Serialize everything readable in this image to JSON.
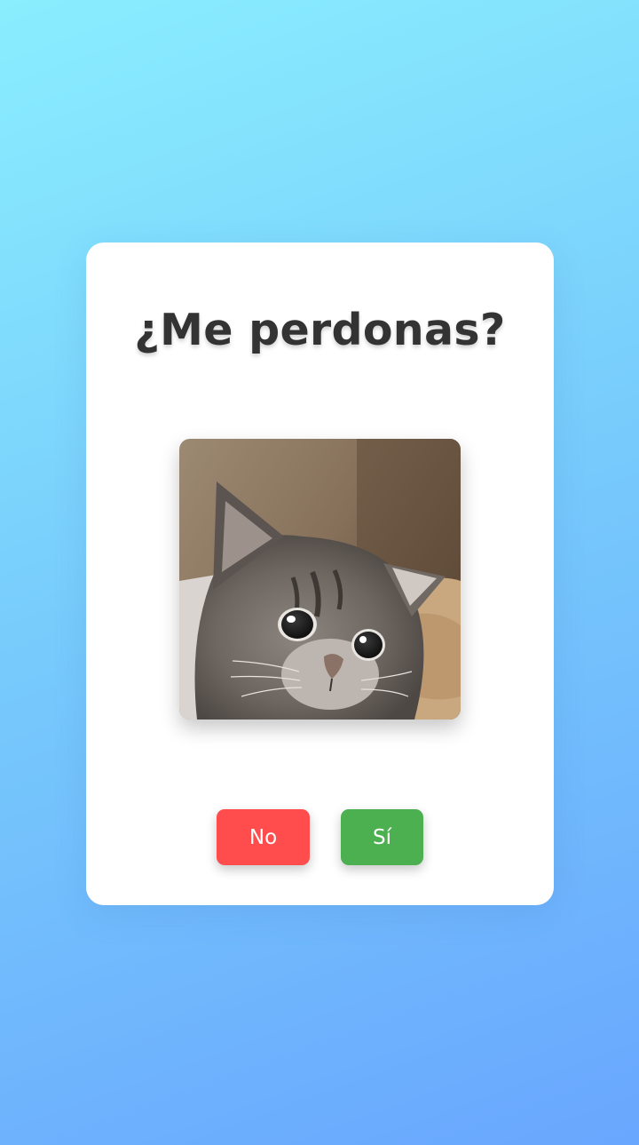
{
  "dialog": {
    "title": "¿Me perdonas?",
    "image_subject": "sad-gray-kitten"
  },
  "buttons": {
    "no_label": "No",
    "yes_label": "Sí"
  },
  "colors": {
    "background_top": "#8aeefe",
    "background_bottom": "#69a6fe",
    "card": "#ffffff",
    "title": "#333333",
    "no_button": "#ff4d4d",
    "yes_button": "#4caf50"
  }
}
